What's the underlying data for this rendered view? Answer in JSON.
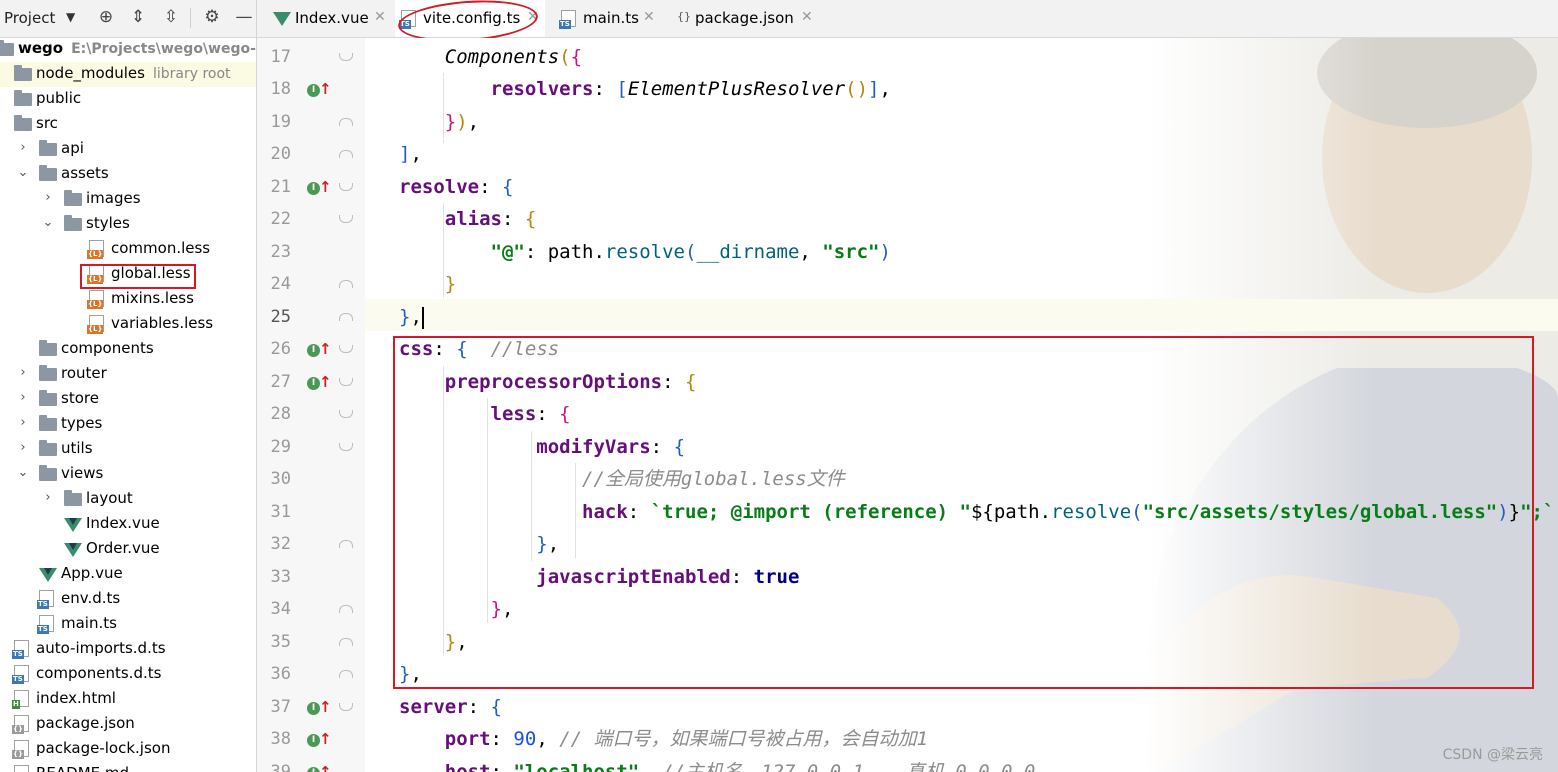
{
  "project_panel": {
    "title": "Project",
    "tree": [
      {
        "label": "wego",
        "hint": "E:\\Projects\\wego\\wego-sep",
        "type": "root"
      },
      {
        "label": "node_modules",
        "hint": "library root",
        "type": "folder"
      },
      {
        "label": "public",
        "type": "folder"
      },
      {
        "label": "src",
        "type": "folder"
      },
      {
        "label": "api",
        "type": "folder"
      },
      {
        "label": "assets",
        "type": "folder"
      },
      {
        "label": "images",
        "type": "folder"
      },
      {
        "label": "styles",
        "type": "folder"
      },
      {
        "label": "common.less",
        "type": "less"
      },
      {
        "label": "global.less",
        "type": "less"
      },
      {
        "label": "mixins.less",
        "type": "less"
      },
      {
        "label": "variables.less",
        "type": "less"
      },
      {
        "label": "components",
        "type": "folder"
      },
      {
        "label": "router",
        "type": "folder"
      },
      {
        "label": "store",
        "type": "folder"
      },
      {
        "label": "types",
        "type": "folder"
      },
      {
        "label": "utils",
        "type": "folder"
      },
      {
        "label": "views",
        "type": "folder"
      },
      {
        "label": "layout",
        "type": "folder"
      },
      {
        "label": "Index.vue",
        "type": "vue"
      },
      {
        "label": "Order.vue",
        "type": "vue"
      },
      {
        "label": "App.vue",
        "type": "vue"
      },
      {
        "label": "env.d.ts",
        "type": "ts"
      },
      {
        "label": "main.ts",
        "type": "ts"
      },
      {
        "label": "auto-imports.d.ts",
        "type": "ts"
      },
      {
        "label": "components.d.ts",
        "type": "ts"
      },
      {
        "label": "index.html",
        "type": "html"
      },
      {
        "label": "package.json",
        "type": "json"
      },
      {
        "label": "package-lock.json",
        "type": "json"
      },
      {
        "label": "README.md",
        "type": "md"
      }
    ]
  },
  "tabs": [
    {
      "label": "Index.vue",
      "icon": "vue-icon"
    },
    {
      "label": "vite.config.ts",
      "icon": "ts-file-icon",
      "active": true
    },
    {
      "label": "main.ts",
      "icon": "ts-file-icon"
    },
    {
      "label": "package.json",
      "icon": "json-file-icon"
    }
  ],
  "editor": {
    "line_numbers": [
      "17",
      "18",
      "19",
      "20",
      "21",
      "22",
      "23",
      "24",
      "25",
      "26",
      "27",
      "28",
      "29",
      "30",
      "31",
      "32",
      "33",
      "34",
      "35",
      "36",
      "37",
      "38",
      "39"
    ],
    "current_line": "25",
    "comments": {
      "less": "//less",
      "global": "//全局使用global.less文件",
      "port": "// 端口号，如果端口号被占用，会自动加1",
      "host": "//主机名，127.0.0.1，  真机 0.0.0.0"
    },
    "values": {
      "port": "90",
      "host": "\"localhost\"",
      "src_str": "\"src\"",
      "at_str": "\"@\"",
      "true_kw": "true",
      "import_path": "\"src/assets/styles/global.less\""
    }
  },
  "watermark": "CSDN @梁云亮"
}
